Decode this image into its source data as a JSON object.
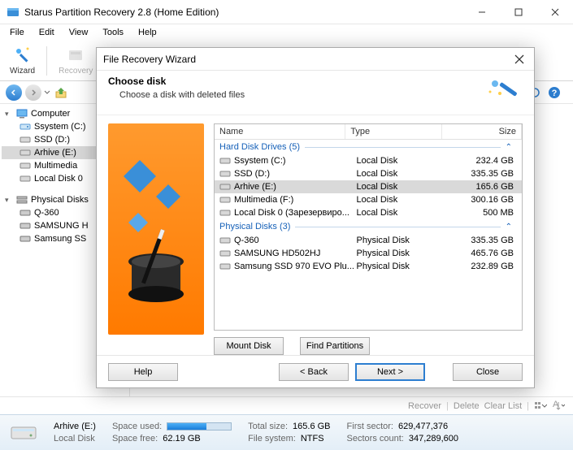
{
  "window": {
    "title": "Starus Partition Recovery 2.8 (Home Edition)"
  },
  "menu": [
    "File",
    "Edit",
    "View",
    "Tools",
    "Help"
  ],
  "toolbar": {
    "wizard": "Wizard",
    "recovery": "Recovery"
  },
  "tree": {
    "computer": "Computer",
    "items1": [
      "Ssystem (C:)",
      "SSD (D:)",
      "Arhive (E:)",
      "Multimedia",
      "Local Disk 0"
    ],
    "physical": "Physical Disks",
    "items2": [
      "Q-360",
      "SAMSUNG H",
      "Samsung SS"
    ]
  },
  "bottom": {
    "recover": "Recover",
    "delete": "Delete",
    "clear": "Clear List"
  },
  "status": {
    "name": "Arhive (E:)",
    "type": "Local Disk",
    "space_used_lbl": "Space used:",
    "space_free_lbl": "Space free:",
    "space_free_val": "62.19 GB",
    "total_lbl": "Total size:",
    "total_val": "165.6 GB",
    "fs_lbl": "File system:",
    "fs_val": "NTFS",
    "first_lbl": "First sector:",
    "first_val": "629,477,376",
    "count_lbl": "Sectors count:",
    "count_val": "347,289,600"
  },
  "wizard": {
    "title": "File Recovery Wizard",
    "heading": "Choose disk",
    "sub": "Choose a disk with deleted files",
    "cols": {
      "name": "Name",
      "type": "Type",
      "size": "Size"
    },
    "group1": "Hard Disk Drives (5)",
    "group2": "Physical Disks (3)",
    "hdd": [
      {
        "name": "Ssystem (C:)",
        "type": "Local Disk",
        "size": "232.4 GB"
      },
      {
        "name": "SSD (D:)",
        "type": "Local Disk",
        "size": "335.35 GB"
      },
      {
        "name": "Arhive (E:)",
        "type": "Local Disk",
        "size": "165.6 GB"
      },
      {
        "name": "Multimedia (F:)",
        "type": "Local Disk",
        "size": "300.16 GB"
      },
      {
        "name": "Local Disk 0 (Зарезервиро...",
        "type": "Local Disk",
        "size": "500 MB"
      }
    ],
    "phys": [
      {
        "name": "Q-360",
        "type": "Physical Disk",
        "size": "335.35 GB"
      },
      {
        "name": "SAMSUNG HD502HJ",
        "type": "Physical Disk",
        "size": "465.76 GB"
      },
      {
        "name": "Samsung SSD 970 EVO Plu...",
        "type": "Physical Disk",
        "size": "232.89 GB"
      }
    ],
    "mount": "Mount Disk",
    "find": "Find Partitions",
    "help": "Help",
    "back": "< Back",
    "next": "Next >",
    "close": "Close"
  }
}
